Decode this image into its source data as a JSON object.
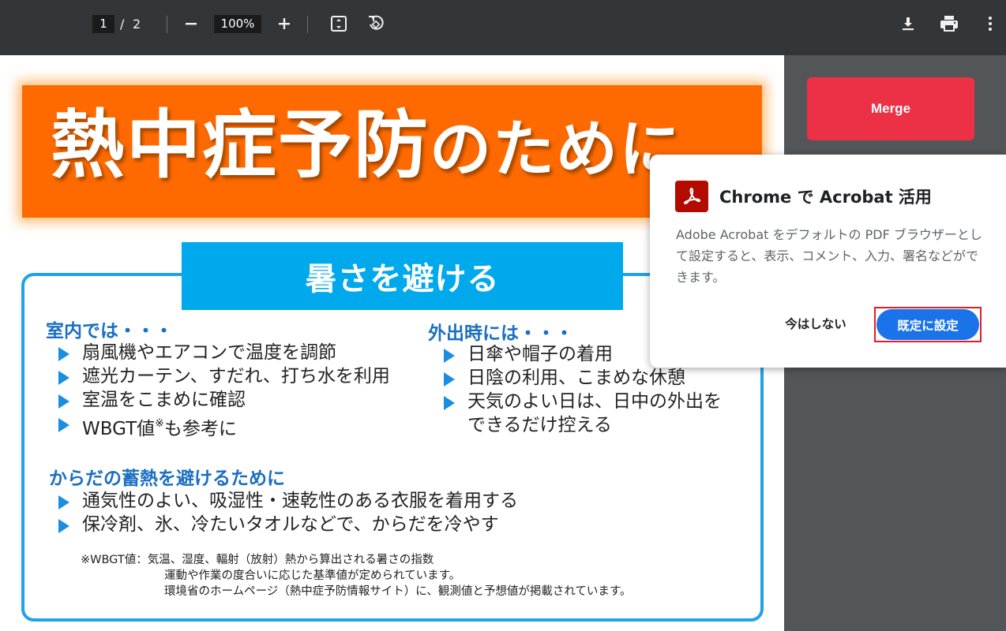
{
  "toolbar": {
    "current_page": "1",
    "page_separator": "/",
    "total_pages": "2",
    "zoom": "100%",
    "icons": [
      "zoom-out-icon",
      "zoom-in-icon",
      "fit-page-icon",
      "rotate-icon",
      "download-icon",
      "print-icon",
      "more-options-icon"
    ]
  },
  "side": {
    "merge_label": "Merge"
  },
  "document": {
    "title_main": "熱中症予防",
    "title_tail": "のために",
    "section_heading": "暑さを避ける",
    "indoor": {
      "heading": "室内では・・・",
      "items": [
        "扇風機やエアコンで温度を調節",
        "遮光カーテン、すだれ、打ち水を利用",
        "室温をこまめに確認",
        "WBGT値",
        "※",
        "も参考に"
      ]
    },
    "outdoor": {
      "heading": "外出時には・・・",
      "items": [
        "日傘や帽子の着用",
        "日陰の利用、こまめな休憩",
        "天気のよい日は、日中の外出を",
        "できるだけ控える"
      ]
    },
    "body_heat": {
      "heading": "からだの蓄熱を避けるために",
      "items": [
        "通気性のよい、吸湿性・速乾性のある衣服を着用する",
        "保冷剤、氷、冷たいタオルなどで、からだを冷やす"
      ]
    },
    "note": {
      "line1": "※WBGT値：気温、湿度、輻射（放射）熱から算出される暑さの指数",
      "line2": "運動や作業の度合いに応じた基準値が定められています。",
      "line3": "環境省のホームページ（熱中症予防情報サイト）に、観測値と予想値が掲載されています。"
    }
  },
  "popup": {
    "title": "Chrome で Acrobat 活用",
    "body": "Adobe Acrobat をデフォルトの PDF ブラウザーとして設定すると、表示、コメント、入力、署名などができます。",
    "later_label": "今はしない",
    "default_label": "既定に設定",
    "accent_color": "#1a73e8",
    "logo_color": "#b30b00"
  }
}
